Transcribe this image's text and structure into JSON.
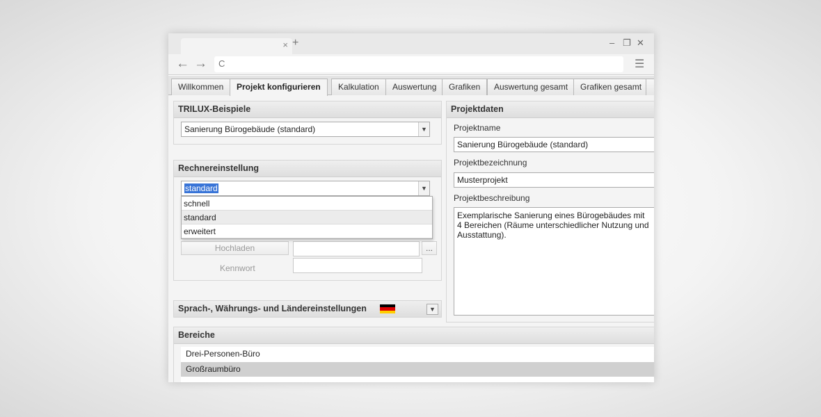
{
  "browser": {
    "tab_close": "×",
    "new_tab": "+",
    "minimize": "–",
    "restore": "❐",
    "close": "✕",
    "back": "←",
    "forward": "→",
    "reload": "C",
    "url": "",
    "menu": "☰"
  },
  "tabs": [
    "Willkommen",
    "Projekt konfigurieren",
    "Kalkulation",
    "Auswertung",
    "Grafiken",
    "Auswertung gesamt",
    "Grafiken gesamt"
  ],
  "examples": {
    "title": "TRILUX-Beispiele",
    "selected": "Sanierung Bürogebäude (standard)"
  },
  "calculator": {
    "title": "Rechnereinstellung",
    "selected": "standard",
    "options": [
      "schnell",
      "standard",
      "erweitert"
    ]
  },
  "import": {
    "upload_label": "Hochladen",
    "browse_label": "...",
    "password_label": "Kennwort"
  },
  "locale": {
    "title": "Sprach-, Währungs- und Ländereinstellungen",
    "flag_colors": [
      "#000000",
      "#dd0000",
      "#ffce00"
    ]
  },
  "project": {
    "title": "Projektdaten",
    "name_label": "Projektname",
    "name_value": "Sanierung Bürogebäude (standard)",
    "designation_label": "Projektbezeichnung",
    "designation_value": "Musterprojekt",
    "description_label": "Projektbeschreibung",
    "description_value": "Exemplarische Sanierung eines Bürogebäudes mit 4 Bereichen (Räume unterschiedlicher Nutzung und Ausstattung)."
  },
  "areas": {
    "title": "Bereiche",
    "items": [
      "Drei-Personen-Büro",
      "Großraumbüro"
    ]
  }
}
